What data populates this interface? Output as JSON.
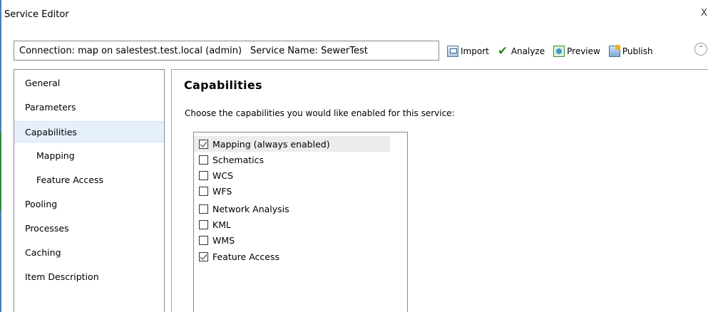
{
  "window": {
    "title": "Service Editor",
    "close_label": "X"
  },
  "connection": {
    "text": "Connection: map on salestest.test.local (admin)",
    "service_name": "Service Name: SewerTest"
  },
  "toolbar": {
    "import_label": "Import",
    "analyze_label": "Analyze",
    "preview_label": "Preview",
    "publish_label": "Publish",
    "collapse_glyph": "⌃"
  },
  "sidebar": {
    "items": [
      {
        "label": "General",
        "sub": false,
        "selected": false
      },
      {
        "label": "Parameters",
        "sub": false,
        "selected": false
      },
      {
        "label": "Capabilities",
        "sub": false,
        "selected": true
      },
      {
        "label": "Mapping",
        "sub": true,
        "selected": false
      },
      {
        "label": "Feature Access",
        "sub": true,
        "selected": false
      },
      {
        "label": "Pooling",
        "sub": false,
        "selected": false
      },
      {
        "label": "Processes",
        "sub": false,
        "selected": false
      },
      {
        "label": "Caching",
        "sub": false,
        "selected": false
      },
      {
        "label": "Item Description",
        "sub": false,
        "selected": false
      }
    ]
  },
  "main": {
    "title": "Capabilities",
    "description": "Choose the capabilities you would like enabled for this service:",
    "capabilities": [
      {
        "label": "Mapping (always enabled)",
        "checked": true
      },
      {
        "label": "Schematics",
        "checked": false
      },
      {
        "label": "WCS",
        "checked": false
      },
      {
        "label": "WFS",
        "checked": false
      },
      {
        "label": "Network Analysis",
        "checked": false
      },
      {
        "label": "KML",
        "checked": false
      },
      {
        "label": "WMS",
        "checked": false
      },
      {
        "label": "Feature Access",
        "checked": true
      }
    ]
  },
  "colors": {
    "selection_bg": "#e6f0fb",
    "check_green": "#2e8b1f",
    "window_edge": "#4a7fb3"
  }
}
